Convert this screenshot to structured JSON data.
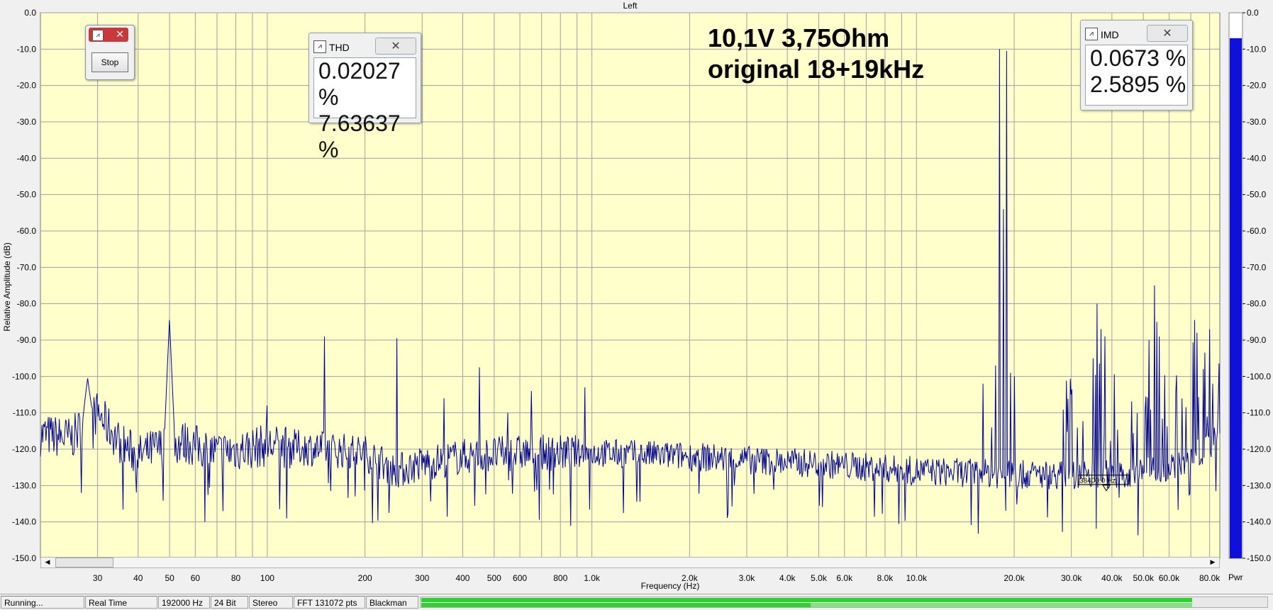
{
  "chart_data": {
    "type": "line",
    "title": "Left",
    "xlabel": "Frequency (Hz)",
    "ylabel": "Relative Amplitude (dB)",
    "xscale": "log",
    "xlim": [
      20,
      86000
    ],
    "ylim": [
      -150,
      0
    ],
    "grid": true,
    "background": "#ffffcc",
    "line_color": "#000090",
    "y_ticks": [
      "0.0",
      "-10.0",
      "-20.0",
      "-30.0",
      "-40.0",
      "-50.0",
      "-60.0",
      "-70.0",
      "-80.0",
      "-90.0",
      "-100.0",
      "-110.0",
      "-120.0",
      "-130.0",
      "-140.0",
      "-150.0"
    ],
    "x_tick_labels": [
      {
        "f": 30,
        "t": "30"
      },
      {
        "f": 40,
        "t": "40"
      },
      {
        "f": 50,
        "t": "50"
      },
      {
        "f": 60,
        "t": "60"
      },
      {
        "f": 80,
        "t": "80"
      },
      {
        "f": 100,
        "t": "100"
      },
      {
        "f": 200,
        "t": "200"
      },
      {
        "f": 300,
        "t": "300"
      },
      {
        "f": 400,
        "t": "400"
      },
      {
        "f": 500,
        "t": "500"
      },
      {
        "f": 600,
        "t": "600"
      },
      {
        "f": 800,
        "t": "800"
      },
      {
        "f": 1000,
        "t": "1.0k"
      },
      {
        "f": 2000,
        "t": "2.0k"
      },
      {
        "f": 3000,
        "t": "3.0k"
      },
      {
        "f": 4000,
        "t": "4.0k"
      },
      {
        "f": 5000,
        "t": "5.0k"
      },
      {
        "f": 6000,
        "t": "6.0k"
      },
      {
        "f": 8000,
        "t": "8.0k"
      },
      {
        "f": 10000,
        "t": "10.0k"
      },
      {
        "f": 20000,
        "t": "20.0k"
      },
      {
        "f": 30000,
        "t": "30.0k"
      },
      {
        "f": 40000,
        "t": "40.0k"
      },
      {
        "f": 50000,
        "t": "50.0k"
      },
      {
        "f": 60000,
        "t": "60.0k"
      },
      {
        "f": 80000,
        "t": "80.0k"
      }
    ],
    "x_grid": [
      30,
      40,
      50,
      60,
      70,
      80,
      90,
      100,
      200,
      300,
      400,
      500,
      600,
      700,
      800,
      900,
      1000,
      2000,
      3000,
      4000,
      5000,
      6000,
      7000,
      8000,
      9000,
      10000,
      20000,
      30000,
      40000,
      50000,
      60000,
      70000,
      80000
    ],
    "series": [
      {
        "baseline": [
          [
            20,
            -116
          ],
          [
            25,
            -117
          ],
          [
            28,
            -112
          ],
          [
            30,
            -110
          ],
          [
            35,
            -118
          ],
          [
            40,
            -122
          ],
          [
            45,
            -120
          ],
          [
            55,
            -118
          ],
          [
            70,
            -121
          ],
          [
            100,
            -119
          ],
          [
            150,
            -120
          ],
          [
            200,
            -121
          ],
          [
            250,
            -126
          ],
          [
            300,
            -124
          ],
          [
            400,
            -122
          ],
          [
            600,
            -121
          ],
          [
            1000,
            -121
          ],
          [
            2000,
            -122
          ],
          [
            3000,
            -123
          ],
          [
            5000,
            -124
          ],
          [
            10000,
            -126
          ],
          [
            20000,
            -127
          ],
          [
            30000,
            -127
          ],
          [
            40000,
            -127
          ],
          [
            50000,
            -126
          ],
          [
            60000,
            -125
          ],
          [
            70000,
            -122
          ],
          [
            80000,
            -119
          ],
          [
            86000,
            -114
          ]
        ],
        "peaks": [
          {
            "f": 28,
            "db": -100.5
          },
          {
            "f": 50,
            "db": -84.5
          },
          {
            "f": 100,
            "db": -108
          },
          {
            "f": 150,
            "db": -89
          },
          {
            "f": 250,
            "db": -89.5
          },
          {
            "f": 350,
            "db": -106
          },
          {
            "f": 450,
            "db": -97.5
          },
          {
            "f": 550,
            "db": -110
          },
          {
            "f": 650,
            "db": -104
          },
          {
            "f": 950,
            "db": -103
          },
          {
            "f": 17000,
            "db": -114
          },
          {
            "f": 18000,
            "db": -10
          },
          {
            "f": 19000,
            "db": -10.5
          },
          {
            "f": 17500,
            "db": -97
          },
          {
            "f": 19500,
            "db": -99
          },
          {
            "f": 18500,
            "db": -54
          },
          {
            "f": 16000,
            "db": -102
          },
          {
            "f": 20000,
            "db": -100
          },
          {
            "f": 36000,
            "db": -80
          },
          {
            "f": 37000,
            "db": -87
          },
          {
            "f": 38000,
            "db": -89
          },
          {
            "f": 35000,
            "db": -95
          },
          {
            "f": 54000,
            "db": -75
          },
          {
            "f": 55000,
            "db": -85
          },
          {
            "f": 52000,
            "db": -90
          },
          {
            "f": 56000,
            "db": -89
          },
          {
            "f": 72000,
            "db": -84.5
          },
          {
            "f": 73000,
            "db": -88
          },
          {
            "f": 80000,
            "db": -87
          },
          {
            "f": 82000,
            "db": -102
          },
          {
            "f": 85000,
            "db": -107
          }
        ]
      }
    ],
    "annotations": [
      "10,1V 3,75Ohm",
      "original 18+19kHz"
    ],
    "marker_label": "38400.0 Hz",
    "meter": {
      "label": "Pwr",
      "level_db": -7,
      "color": "#1010dd",
      "ticks": [
        "0.0",
        "-10.0",
        "-20.0",
        "-30.0",
        "-40.0",
        "-50.0",
        "-60.0",
        "-70.0",
        "-80.0",
        "-90.0",
        "-100.0",
        "-110.0",
        "-120.0",
        "-130.0",
        "-140.0",
        "-150.0"
      ]
    }
  },
  "thd_window": {
    "title": "THD",
    "values": [
      "0.02027 %",
      "7.63637 %"
    ],
    "close": "✕"
  },
  "imd_window": {
    "title": "IMD",
    "values": [
      "0.0673 %",
      "2.5895 %"
    ],
    "close": "✕"
  },
  "stop_window": {
    "button": "Stop",
    "close": "✕"
  },
  "status_bar": {
    "cells": [
      "Running...",
      "Real Time",
      "192000 Hz",
      "24 Bit",
      "Stereo",
      "FFT 131072 pts",
      "Blackman"
    ],
    "level_left": 0.91,
    "level_right": 0.46
  },
  "scrollbar": {
    "left_arrow": "◀",
    "right_arrow": "▶"
  }
}
